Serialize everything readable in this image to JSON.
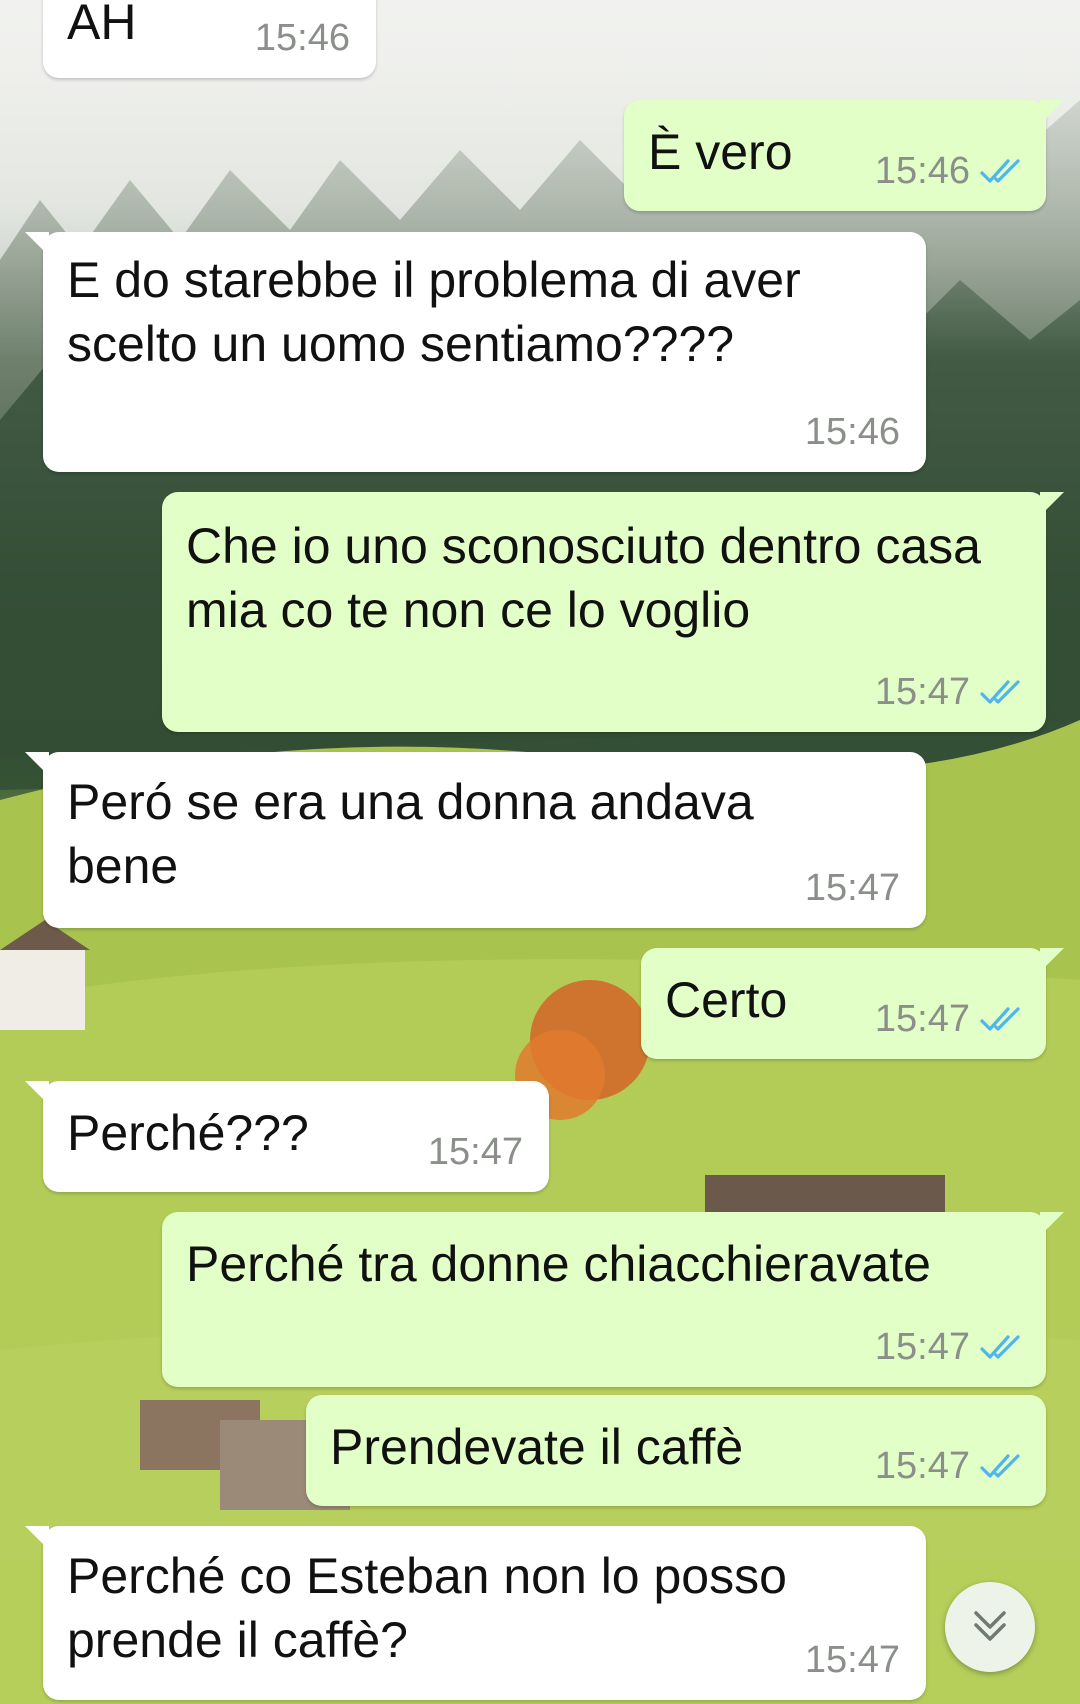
{
  "messages": [
    {
      "dir": "in",
      "text": "AH",
      "time": "15:46"
    },
    {
      "dir": "out",
      "text": "È vero",
      "time": "15:46",
      "read": true
    },
    {
      "dir": "in",
      "text": "E do starebbe il problema di aver scelto un uomo sentiamo????",
      "time": "15:46"
    },
    {
      "dir": "out",
      "text": "Che io uno sconosciuto dentro casa mia co te non ce lo voglio",
      "time": "15:47",
      "read": true
    },
    {
      "dir": "in",
      "text": "Peró se era una donna andava bene",
      "time": "15:47"
    },
    {
      "dir": "out",
      "text": "Certo",
      "time": "15:47",
      "read": true
    },
    {
      "dir": "in",
      "text": "Perché???",
      "time": "15:47"
    },
    {
      "dir": "out",
      "text": "Perché tra donne chiacchieravate",
      "time": "15:47",
      "read": true
    },
    {
      "dir": "out",
      "text": "Prendevate il caffè",
      "time": "15:47",
      "read": true
    },
    {
      "dir": "in",
      "text": "Perché co Esteban non lo posso prende il caffè?",
      "time": "15:47"
    }
  ],
  "colors": {
    "incoming_bubble": "#ffffff",
    "outgoing_bubble": "#e2ffc7",
    "read_ticks": "#4fb6ec",
    "timestamp": "#8a8f8a"
  },
  "icons": {
    "read_receipt": "double-check-icon",
    "scroll_down": "double-chevron-down-icon"
  }
}
